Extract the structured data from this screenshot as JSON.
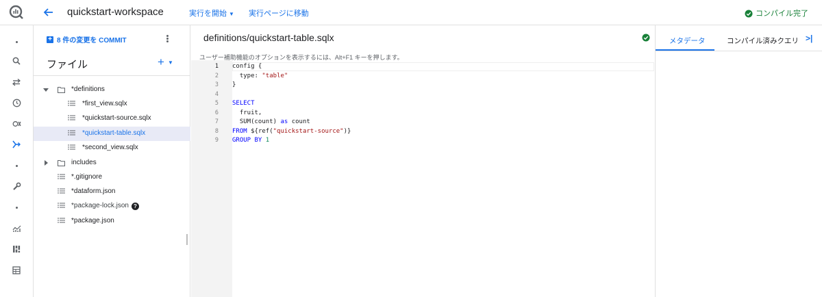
{
  "header": {
    "workspace_title": "quickstart-workspace",
    "run_menu": "実行を開始",
    "go_to_runs": "実行ページに移動",
    "compile_status": "コンパイル完了"
  },
  "file_panel": {
    "commit_label": "8 件の変更を COMMIT",
    "title": "ファイル",
    "add_label": "+",
    "items": [
      {
        "label": "*definitions",
        "type": "folder",
        "expanded": true
      },
      {
        "label": "*first_view.sqlx",
        "type": "file"
      },
      {
        "label": "*quickstart-source.sqlx",
        "type": "file"
      },
      {
        "label": "*quickstart-table.sqlx",
        "type": "file",
        "selected": true
      },
      {
        "label": "*second_view.sqlx",
        "type": "file"
      },
      {
        "label": "includes",
        "type": "folder",
        "expanded": false
      },
      {
        "label": "*.gitignore",
        "type": "file"
      },
      {
        "label": "*dataform.json",
        "type": "file"
      },
      {
        "label": "*package-lock.json",
        "type": "file"
      },
      {
        "label": "*package.json",
        "type": "file"
      }
    ]
  },
  "editor": {
    "file_path": "definitions/quickstart-table.sqlx",
    "a11y_hint": "ユーザー補助機能のオプションを表示するには、Alt+F1 キーを押します。",
    "line_numbers": [
      "1",
      "2",
      "3",
      "4",
      "5",
      "6",
      "7",
      "8",
      "9"
    ],
    "code": {
      "l1_a": "config {",
      "l2_a": "  type: ",
      "l2_b": "\"table\"",
      "l3_a": "}",
      "l5_a": "SELECT",
      "l6_a": "  fruit,",
      "l7_a": "  SUM(count) ",
      "l7_b": "as",
      "l7_c": " count",
      "l8_a": "FROM",
      "l8_b": " ${ref(",
      "l8_c": "\"quickstart-source\"",
      "l8_d": ")}",
      "l9_a": "GROUP BY",
      "l9_b": " ",
      "l9_c": "1"
    }
  },
  "right_panel": {
    "tab_metadata": "メタデータ",
    "tab_compiled": "コンパイル済みクエリ",
    "collapse_label": ">|"
  },
  "colors": {
    "accent": "#1a73e8",
    "success": "#188038",
    "selected_row": "#e8eaf6"
  }
}
